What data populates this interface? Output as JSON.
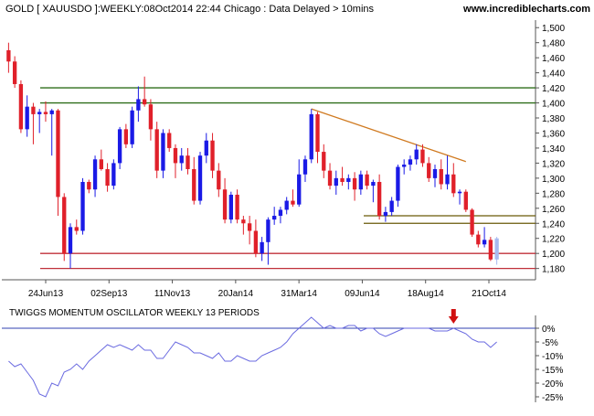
{
  "header": {
    "title": "GOLD [ XAUUSDO ]:WEEKLY:08Oct2014 22:44 Chicago : Data Delayed > 10mins",
    "website": "www.incrediblecharts.com"
  },
  "colors": {
    "up": "#1a1ae6",
    "down": "#e0202a",
    "last_candle": "#a7b9f0",
    "support": "#c0303a",
    "resistance": "#2e6e1a",
    "band": "#6a5a08",
    "trend": "#d07a20",
    "oscillator": "#6a6ae0",
    "zero": "#3040b0",
    "signal_arrow": "#d01010",
    "axis": "#555555"
  },
  "chart_data": [
    {
      "type": "candlestick",
      "name": "price",
      "x_labels": [
        "24Jun13",
        "02Sep13",
        "11Nov13",
        "20Jan14",
        "31Mar14",
        "09Jun14",
        "18Aug14",
        "21Oct14"
      ],
      "ylim": [
        1165,
        1510
      ],
      "y_ticks": [
        "1,180",
        "1,200",
        "1,220",
        "1,240",
        "1,260",
        "1,280",
        "1,300",
        "1,320",
        "1,340",
        "1,360",
        "1,380",
        "1,400",
        "1,420",
        "1,440",
        "1,460",
        "1,480",
        "1,500"
      ],
      "candles": [
        [
          1470,
          1480,
          1440,
          1455
        ],
        [
          1455,
          1462,
          1420,
          1425
        ],
        [
          1425,
          1430,
          1360,
          1365
        ],
        [
          1365,
          1410,
          1355,
          1395
        ],
        [
          1395,
          1400,
          1345,
          1385
        ],
        [
          1385,
          1392,
          1360,
          1388
        ],
        [
          1388,
          1402,
          1375,
          1385
        ],
        [
          1385,
          1392,
          1330,
          1390
        ],
        [
          1390,
          1392,
          1250,
          1275
        ],
        [
          1275,
          1280,
          1190,
          1200
        ],
        [
          1200,
          1240,
          1180,
          1235
        ],
        [
          1235,
          1245,
          1225,
          1230
        ],
        [
          1230,
          1300,
          1225,
          1295
        ],
        [
          1295,
          1298,
          1280,
          1285
        ],
        [
          1285,
          1330,
          1275,
          1325
        ],
        [
          1325,
          1338,
          1310,
          1312
        ],
        [
          1312,
          1320,
          1282,
          1290
        ],
        [
          1290,
          1325,
          1285,
          1320
        ],
        [
          1320,
          1368,
          1312,
          1365
        ],
        [
          1365,
          1372,
          1340,
          1345
        ],
        [
          1345,
          1395,
          1340,
          1390
        ],
        [
          1390,
          1422,
          1375,
          1405
        ],
        [
          1405,
          1435,
          1395,
          1398
        ],
        [
          1398,
          1405,
          1350,
          1365
        ],
        [
          1365,
          1375,
          1300,
          1310
        ],
        [
          1310,
          1365,
          1300,
          1360
        ],
        [
          1360,
          1365,
          1335,
          1340
        ],
        [
          1340,
          1345,
          1300,
          1320
        ],
        [
          1320,
          1340,
          1310,
          1330
        ],
        [
          1330,
          1340,
          1305,
          1312
        ],
        [
          1312,
          1328,
          1265,
          1270
        ],
        [
          1270,
          1335,
          1265,
          1330
        ],
        [
          1330,
          1360,
          1320,
          1350
        ],
        [
          1350,
          1360,
          1300,
          1310
        ],
        [
          1310,
          1320,
          1275,
          1285
        ],
        [
          1285,
          1300,
          1240,
          1245
        ],
        [
          1245,
          1282,
          1240,
          1278
        ],
        [
          1278,
          1285,
          1240,
          1245
        ],
        [
          1245,
          1250,
          1225,
          1240
        ],
        [
          1240,
          1250,
          1212,
          1230
        ],
        [
          1230,
          1245,
          1195,
          1200
        ],
        [
          1200,
          1222,
          1190,
          1215
        ],
        [
          1215,
          1248,
          1185,
          1245
        ],
        [
          1245,
          1262,
          1238,
          1250
        ],
        [
          1250,
          1262,
          1240,
          1258
        ],
        [
          1258,
          1275,
          1252,
          1270
        ],
        [
          1270,
          1285,
          1262,
          1265
        ],
        [
          1265,
          1325,
          1262,
          1305
        ],
        [
          1305,
          1330,
          1295,
          1325
        ],
        [
          1325,
          1392,
          1320,
          1385
        ],
        [
          1385,
          1388,
          1320,
          1335
        ],
        [
          1335,
          1345,
          1300,
          1310
        ],
        [
          1310,
          1320,
          1285,
          1290
        ],
        [
          1290,
          1310,
          1278,
          1300
        ],
        [
          1300,
          1315,
          1290,
          1295
        ],
        [
          1295,
          1305,
          1285,
          1300
        ],
        [
          1300,
          1308,
          1270,
          1285
        ],
        [
          1285,
          1310,
          1278,
          1305
        ],
        [
          1305,
          1310,
          1285,
          1290
        ],
        [
          1290,
          1298,
          1268,
          1295
        ],
        [
          1295,
          1305,
          1245,
          1250
        ],
        [
          1250,
          1262,
          1242,
          1255
        ],
        [
          1255,
          1275,
          1250,
          1270
        ],
        [
          1270,
          1318,
          1262,
          1315
        ],
        [
          1315,
          1325,
          1305,
          1318
        ],
        [
          1318,
          1330,
          1310,
          1325
        ],
        [
          1325,
          1345,
          1318,
          1338
        ],
        [
          1338,
          1345,
          1315,
          1320
        ],
        [
          1320,
          1328,
          1295,
          1300
        ],
        [
          1300,
          1318,
          1288,
          1312
        ],
        [
          1312,
          1325,
          1285,
          1292
        ],
        [
          1292,
          1330,
          1285,
          1305
        ],
        [
          1305,
          1320,
          1275,
          1280
        ],
        [
          1280,
          1285,
          1265,
          1282
        ],
        [
          1282,
          1285,
          1255,
          1258
        ],
        [
          1258,
          1260,
          1222,
          1225
        ],
        [
          1225,
          1230,
          1208,
          1212
        ],
        [
          1212,
          1235,
          1208,
          1218
        ],
        [
          1218,
          1222,
          1190,
          1192
        ],
        [
          1192,
          1222,
          1185,
          1220
        ]
      ],
      "hlines": [
        {
          "value": 1420,
          "role": "resistance"
        },
        {
          "value": 1400,
          "role": "resistance"
        },
        {
          "value": 1250,
          "role": "band"
        },
        {
          "value": 1240,
          "role": "band"
        },
        {
          "value": 1200,
          "role": "support"
        },
        {
          "value": 1180,
          "role": "support"
        }
      ],
      "trendline": {
        "from": [
          49,
          1392
        ],
        "to": [
          74,
          1322
        ]
      }
    },
    {
      "type": "line",
      "title": "TWIGGS MOMENTUM OSCILLATOR WEEKLY 13 PERIODS",
      "ylim": [
        -27,
        3
      ],
      "y_ticks": [
        "0%",
        "-5%",
        "-10%",
        "-15%",
        "-20%",
        "-25%"
      ],
      "zero_line": 0,
      "signal_arrow_index": 72,
      "values": [
        -12,
        -14,
        -13,
        -16,
        -19,
        -24,
        -25,
        -20,
        -21,
        -16,
        -15,
        -13,
        -15,
        -12,
        -10,
        -8,
        -6,
        -7,
        -6,
        -7,
        -8,
        -6,
        -8,
        -8,
        -11,
        -11,
        -8,
        -5,
        -6,
        -7,
        -9,
        -9,
        -10,
        -11,
        -9,
        -12,
        -12,
        -10,
        -11,
        -12,
        -12,
        -10,
        -9,
        -8,
        -7,
        -5,
        -2,
        0,
        2,
        4,
        2,
        0,
        1,
        0,
        0,
        1,
        1,
        -1,
        0,
        0,
        -2,
        -3,
        -2,
        -1,
        0,
        0,
        0,
        0,
        0,
        -1,
        -1,
        -1,
        0,
        -1,
        -2,
        -4,
        -5,
        -5,
        -7,
        -5
      ]
    }
  ]
}
